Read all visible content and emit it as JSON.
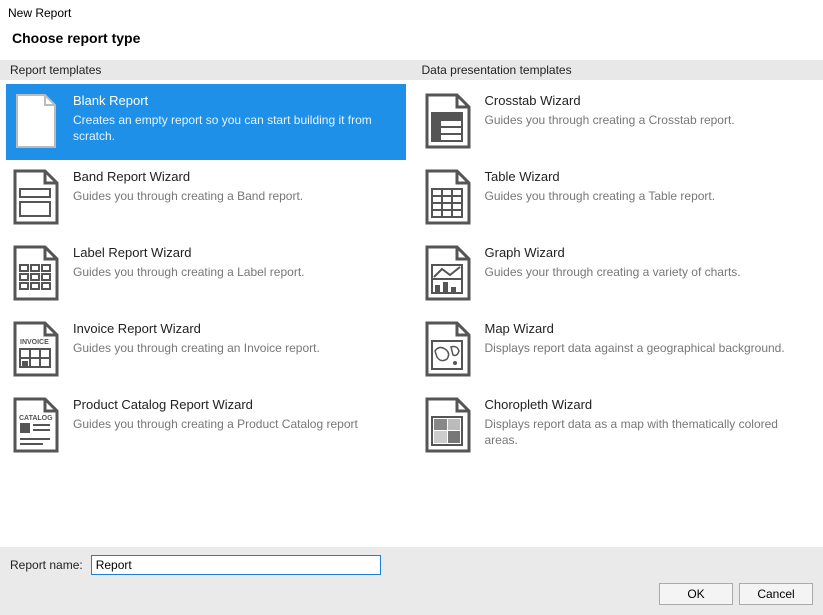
{
  "window_title": "New Report",
  "heading": "Choose report type",
  "left": {
    "header": "Report templates",
    "items": [
      {
        "title": "Blank Report",
        "desc": "Creates an empty report so you can start building it from scratch.",
        "icon": "blank",
        "selected": true
      },
      {
        "title": "Band Report Wizard",
        "desc": "Guides you through creating a Band report.",
        "icon": "band"
      },
      {
        "title": "Label Report Wizard",
        "desc": "Guides you through creating a Label report.",
        "icon": "label"
      },
      {
        "title": "Invoice Report Wizard",
        "desc": "Guides you through creating an Invoice report.",
        "icon": "invoice"
      },
      {
        "title": "Product Catalog Report Wizard",
        "desc": "Guides you through creating a Product Catalog report",
        "icon": "catalog"
      }
    ]
  },
  "right": {
    "header": "Data presentation templates",
    "items": [
      {
        "title": "Crosstab Wizard",
        "desc": "Guides you through creating a Crosstab report.",
        "icon": "crosstab"
      },
      {
        "title": "Table Wizard",
        "desc": "Guides you through creating a Table report.",
        "icon": "table"
      },
      {
        "title": "Graph Wizard",
        "desc": "Guides your through creating a variety of charts.",
        "icon": "graph"
      },
      {
        "title": "Map Wizard",
        "desc": "Displays report data against a geographical background.",
        "icon": "map"
      },
      {
        "title": "Choropleth Wizard",
        "desc": "Displays report data as a map with thematically colored areas.",
        "icon": "choropleth"
      }
    ]
  },
  "footer": {
    "label": "Report name:",
    "value": "Report",
    "ok": "OK",
    "cancel": "Cancel"
  }
}
